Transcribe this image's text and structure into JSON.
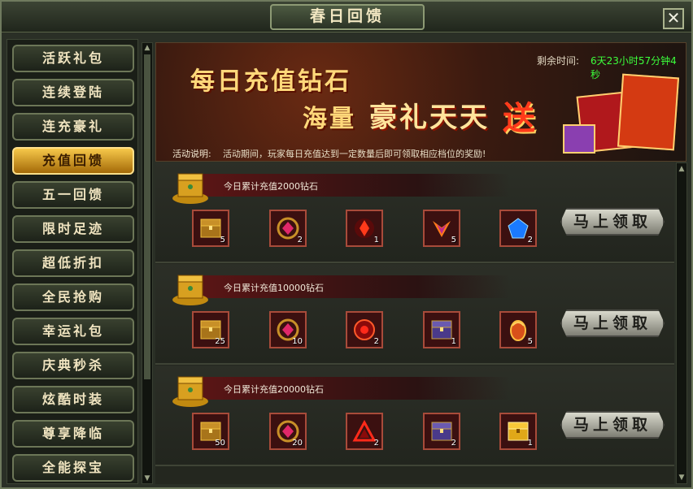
{
  "window": {
    "title": "春日回馈",
    "close_label": "✕"
  },
  "sidebar": {
    "items": [
      {
        "label": "活跃礼包",
        "active": false
      },
      {
        "label": "连续登陆",
        "active": false
      },
      {
        "label": "连充豪礼",
        "active": false
      },
      {
        "label": "充值回馈",
        "active": true
      },
      {
        "label": "五一回馈",
        "active": false
      },
      {
        "label": "限时足迹",
        "active": false
      },
      {
        "label": "超低折扣",
        "active": false
      },
      {
        "label": "全民抢购",
        "active": false
      },
      {
        "label": "幸运礼包",
        "active": false
      },
      {
        "label": "庆典秒杀",
        "active": false
      },
      {
        "label": "炫酷时装",
        "active": false
      },
      {
        "label": "尊享降临",
        "active": false
      },
      {
        "label": "全能探宝",
        "active": false
      }
    ]
  },
  "banner": {
    "line1": "每日充值钻石",
    "line2a": "海量",
    "line2b": "豪礼天天",
    "line2c": "送",
    "remain_label": "剩余时间:",
    "remain_value": "6天23小时57分钟4秒",
    "desc_label": "活动说明:",
    "desc_text": "活动期间，玩家每日充值达到一定数量后即可领取相应档位的奖励!"
  },
  "tiers": [
    {
      "title": "今日累计充值2000钻石",
      "claim_label": "马上领取",
      "rewards": [
        {
          "icon": "treasure-chest-icon",
          "count": "5"
        },
        {
          "icon": "red-gem-ring-icon",
          "count": "2"
        },
        {
          "icon": "red-crystal-icon",
          "count": "1"
        },
        {
          "icon": "fire-wing-icon",
          "count": "5"
        },
        {
          "icon": "blue-gem-icon",
          "count": "2"
        }
      ]
    },
    {
      "title": "今日累计充值10000钻石",
      "claim_label": "马上领取",
      "rewards": [
        {
          "icon": "treasure-chest-icon",
          "count": "25"
        },
        {
          "icon": "red-gem-ring-icon",
          "count": "10"
        },
        {
          "icon": "red-orb-icon",
          "count": "2"
        },
        {
          "icon": "purple-chest-icon",
          "count": "1"
        },
        {
          "icon": "dragon-egg-icon",
          "count": "5"
        }
      ]
    },
    {
      "title": "今日累计充值20000钻石",
      "claim_label": "马上领取",
      "rewards": [
        {
          "icon": "treasure-chest-icon",
          "count": "50"
        },
        {
          "icon": "red-gem-ring-icon",
          "count": "20"
        },
        {
          "icon": "red-triangle-icon",
          "count": "2"
        },
        {
          "icon": "purple-chest-icon",
          "count": "2"
        },
        {
          "icon": "golden-chest-icon",
          "count": "1"
        }
      ]
    }
  ],
  "colors": {
    "accent_gold": "#f6c84a",
    "remain_green": "#3cff3c",
    "tier_band_red": "#5a1515"
  }
}
